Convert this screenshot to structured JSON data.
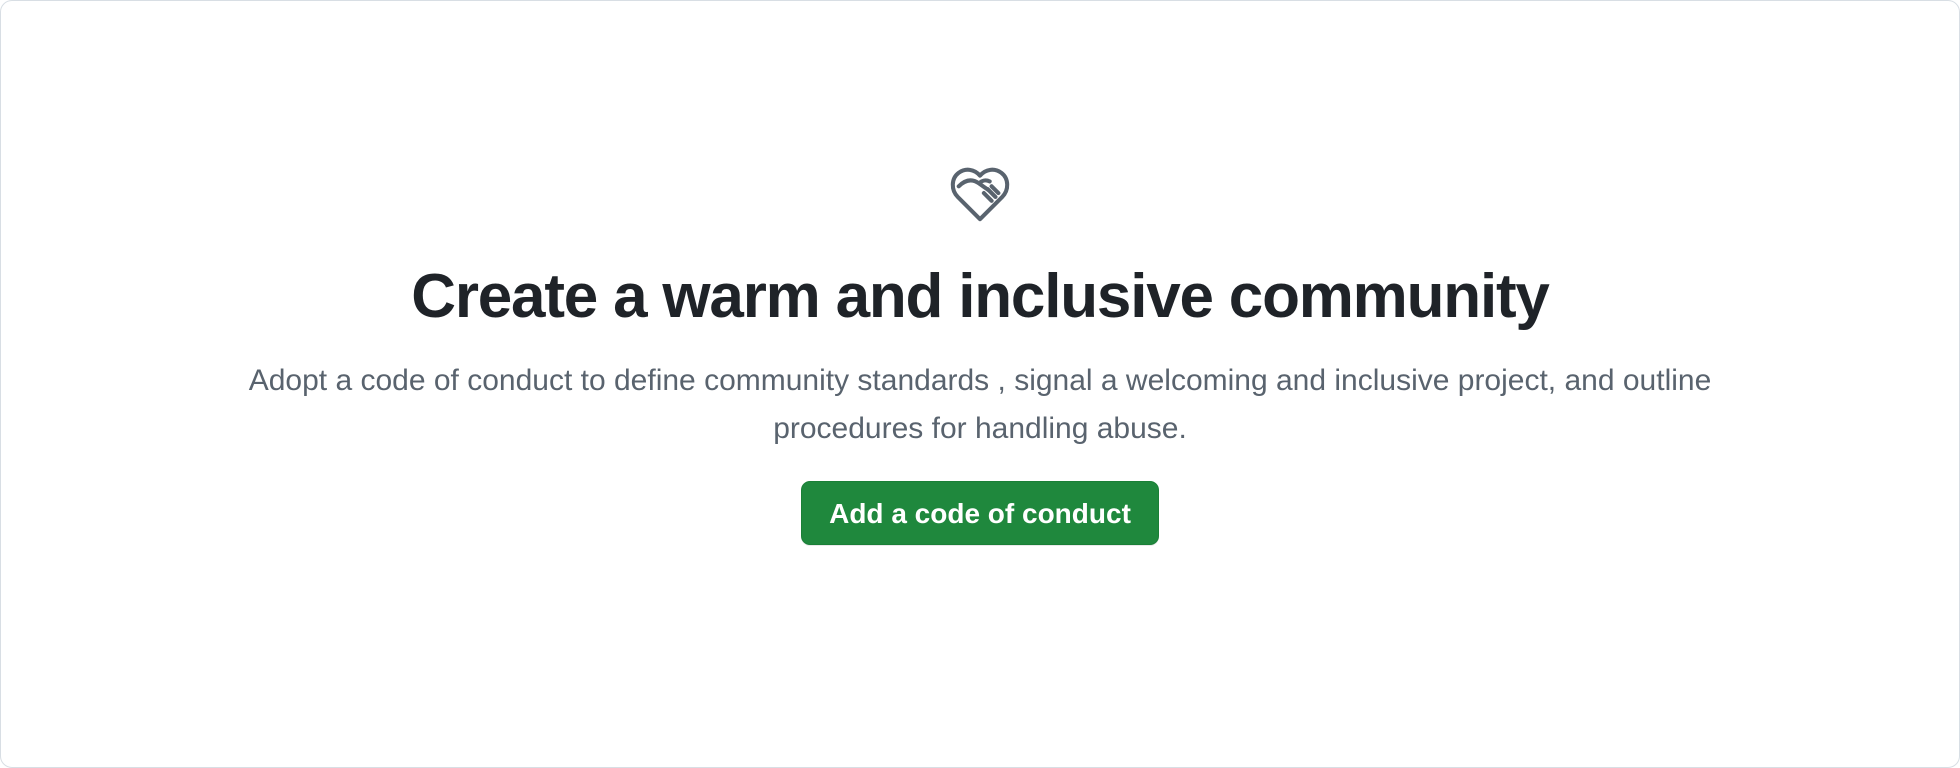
{
  "blankslate": {
    "icon": "heart-handshake-icon",
    "heading": "Create a warm and inclusive community",
    "description": "Adopt a code of conduct to define community standards , signal a welcoming and inclusive project, and outline procedures for handling abuse.",
    "primary_action_label": "Add a code of conduct"
  },
  "colors": {
    "heading": "#1f2328",
    "muted_text": "#59636e",
    "icon": "#59636e",
    "primary_button_bg": "#1f883d",
    "primary_button_text": "#ffffff",
    "border": "#d8dee4"
  }
}
